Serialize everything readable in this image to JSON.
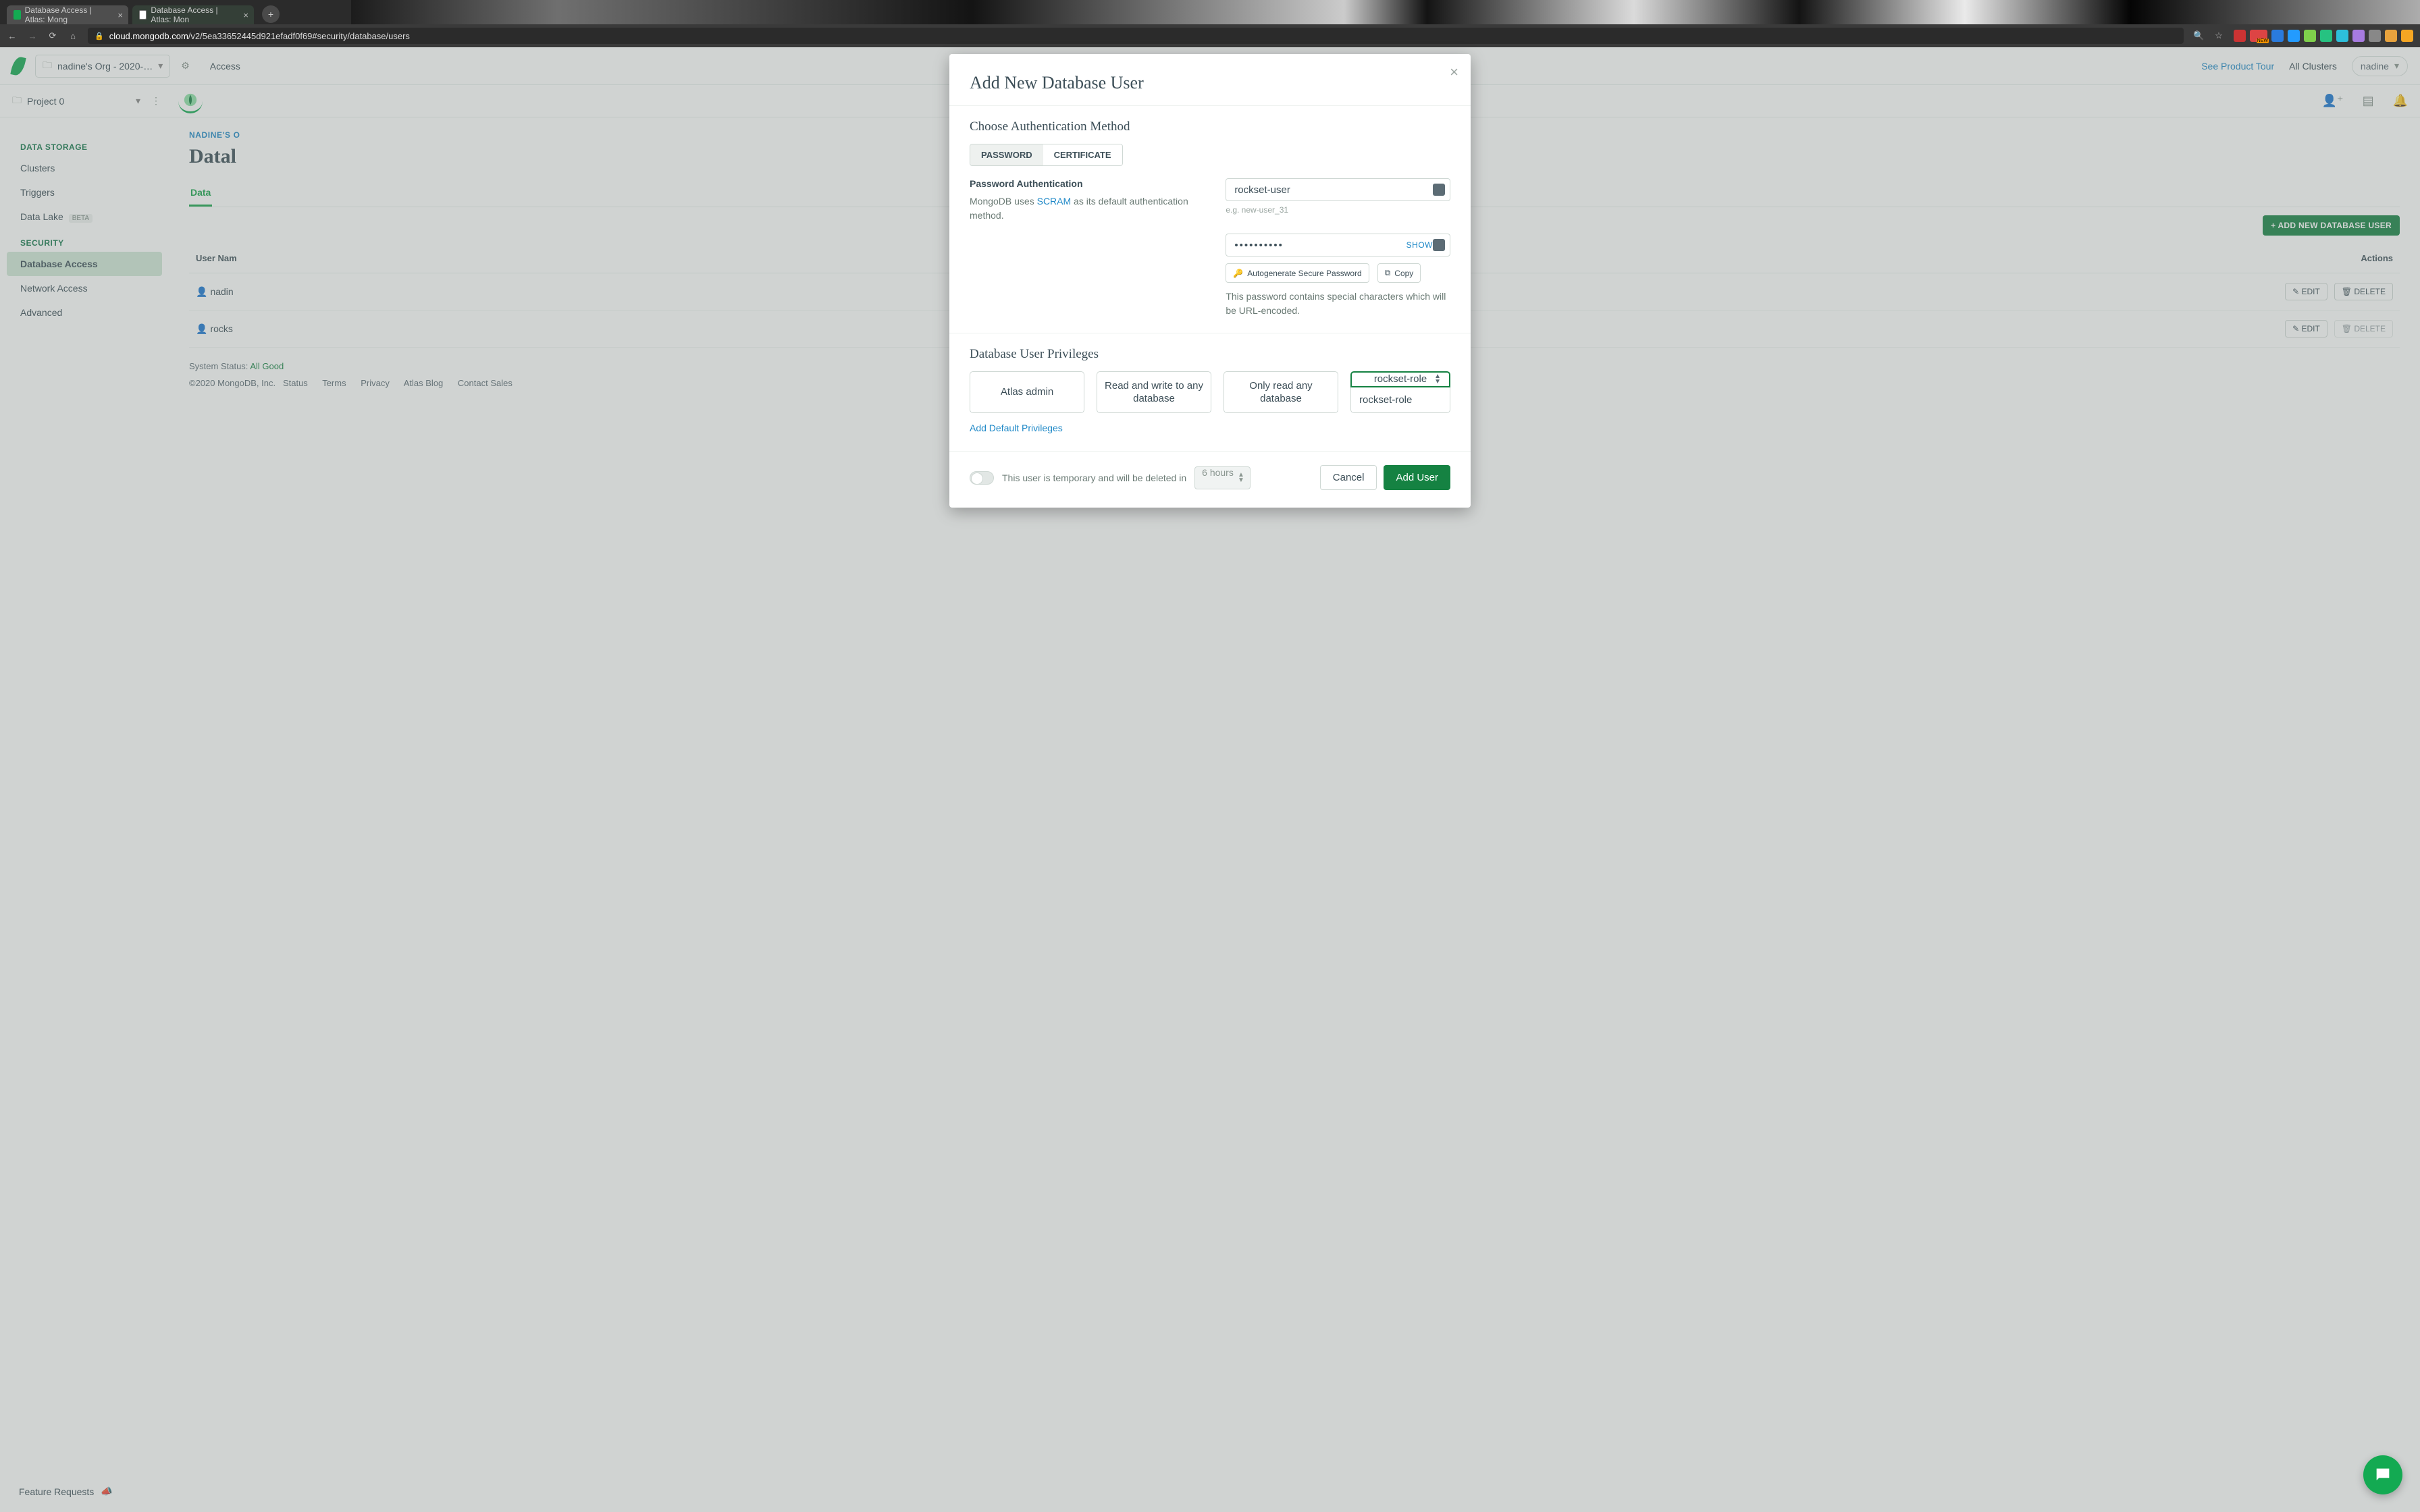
{
  "browser": {
    "tab1": "Database Access | Atlas: Mong",
    "tab2": "Database Access | Atlas: Mon",
    "url_host": "cloud.mongodb.com",
    "url_path": "/v2/5ea33652445d921efadf0f69#security/database/users"
  },
  "topbar": {
    "org": "nadine's Org - 2020-…",
    "nav_access": "Access",
    "product_tour": "See Product Tour",
    "all_clusters": "All Clusters",
    "user": "nadine"
  },
  "subbar": {
    "project": "Project 0"
  },
  "sidebar": {
    "section1": "DATA STORAGE",
    "items1": [
      "Clusters",
      "Triggers",
      "Data Lake"
    ],
    "beta": "BETA",
    "section2": "SECURITY",
    "items2": [
      "Database Access",
      "Network Access",
      "Advanced"
    ],
    "feature_requests": "Feature Requests"
  },
  "main": {
    "breadcrumb": "NADINE'S O",
    "title": "Datal",
    "tab_data": "Data",
    "add_button": "+ ADD NEW DATABASE USER",
    "col_user": "User Nam",
    "col_actions": "Actions",
    "row1_user": "nadin",
    "row2_user": "rocks",
    "edit": "EDIT",
    "delete": "DELETE"
  },
  "footer": {
    "status_label": "System Status:",
    "status_value": "All Good",
    "copyright": "©2020 MongoDB, Inc.",
    "links": [
      "Status",
      "Terms",
      "Privacy",
      "Atlas Blog",
      "Contact Sales"
    ]
  },
  "modal": {
    "title": "Add New Database User",
    "auth_section": "Choose Authentication Method",
    "seg_password": "PASSWORD",
    "seg_cert": "CERTIFICATE",
    "pa_title": "Password Authentication",
    "pa_desc_pre": "MongoDB uses ",
    "pa_desc_link": "SCRAM",
    "pa_desc_post": " as its default authentication method.",
    "username_value": "rockset-user",
    "username_hint": "e.g. new-user_31",
    "password_value": "••••••••••",
    "show_label": "SHOW",
    "autogen": "Autogenerate Secure Password",
    "copy": "Copy",
    "pw_note": "This password contains special characters which will be URL-encoded.",
    "priv_section": "Database User Privileges",
    "priv_opts": [
      "Atlas admin",
      "Read and write to any database",
      "Only read any database"
    ],
    "priv_custom": "rockset-role",
    "priv_dd_item": "rockset-role",
    "add_default": "Add Default Privileges",
    "temp_text": "This user is temporary and will be deleted in",
    "duration": "6 hours",
    "cancel": "Cancel",
    "add_user": "Add User"
  }
}
